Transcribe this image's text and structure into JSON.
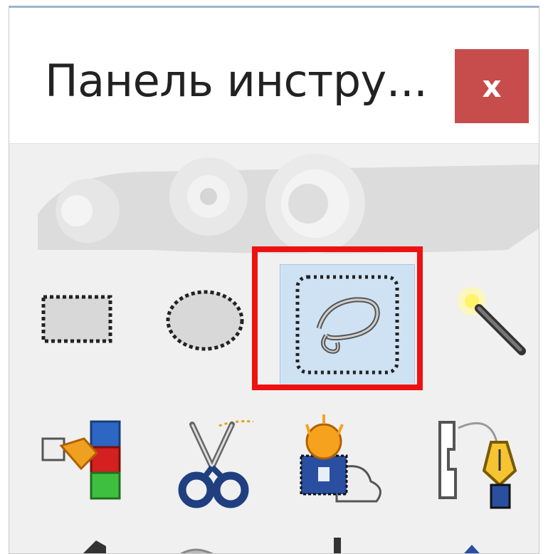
{
  "window": {
    "title": "Панель инстру...",
    "close_label": "x"
  },
  "colors": {
    "close_bg": "#c74c4c",
    "highlight_border": "#ee1111",
    "active_tool_bg": "#cfe2f3"
  },
  "tools": [
    {
      "name": "rect-select-tool",
      "icon": "rect-select-icon"
    },
    {
      "name": "ellipse-select-tool",
      "icon": "ellipse-select-icon"
    },
    {
      "name": "free-select-tool",
      "icon": "lasso-icon",
      "active": true
    },
    {
      "name": "fuzzy-select-tool",
      "icon": "magic-wand-icon"
    },
    {
      "name": "select-by-color-tool",
      "icon": "color-select-icon"
    },
    {
      "name": "scissors-select-tool",
      "icon": "scissors-icon"
    },
    {
      "name": "foreground-select-tool",
      "icon": "foreground-select-icon"
    },
    {
      "name": "paths-tool",
      "icon": "pen-path-icon"
    }
  ]
}
